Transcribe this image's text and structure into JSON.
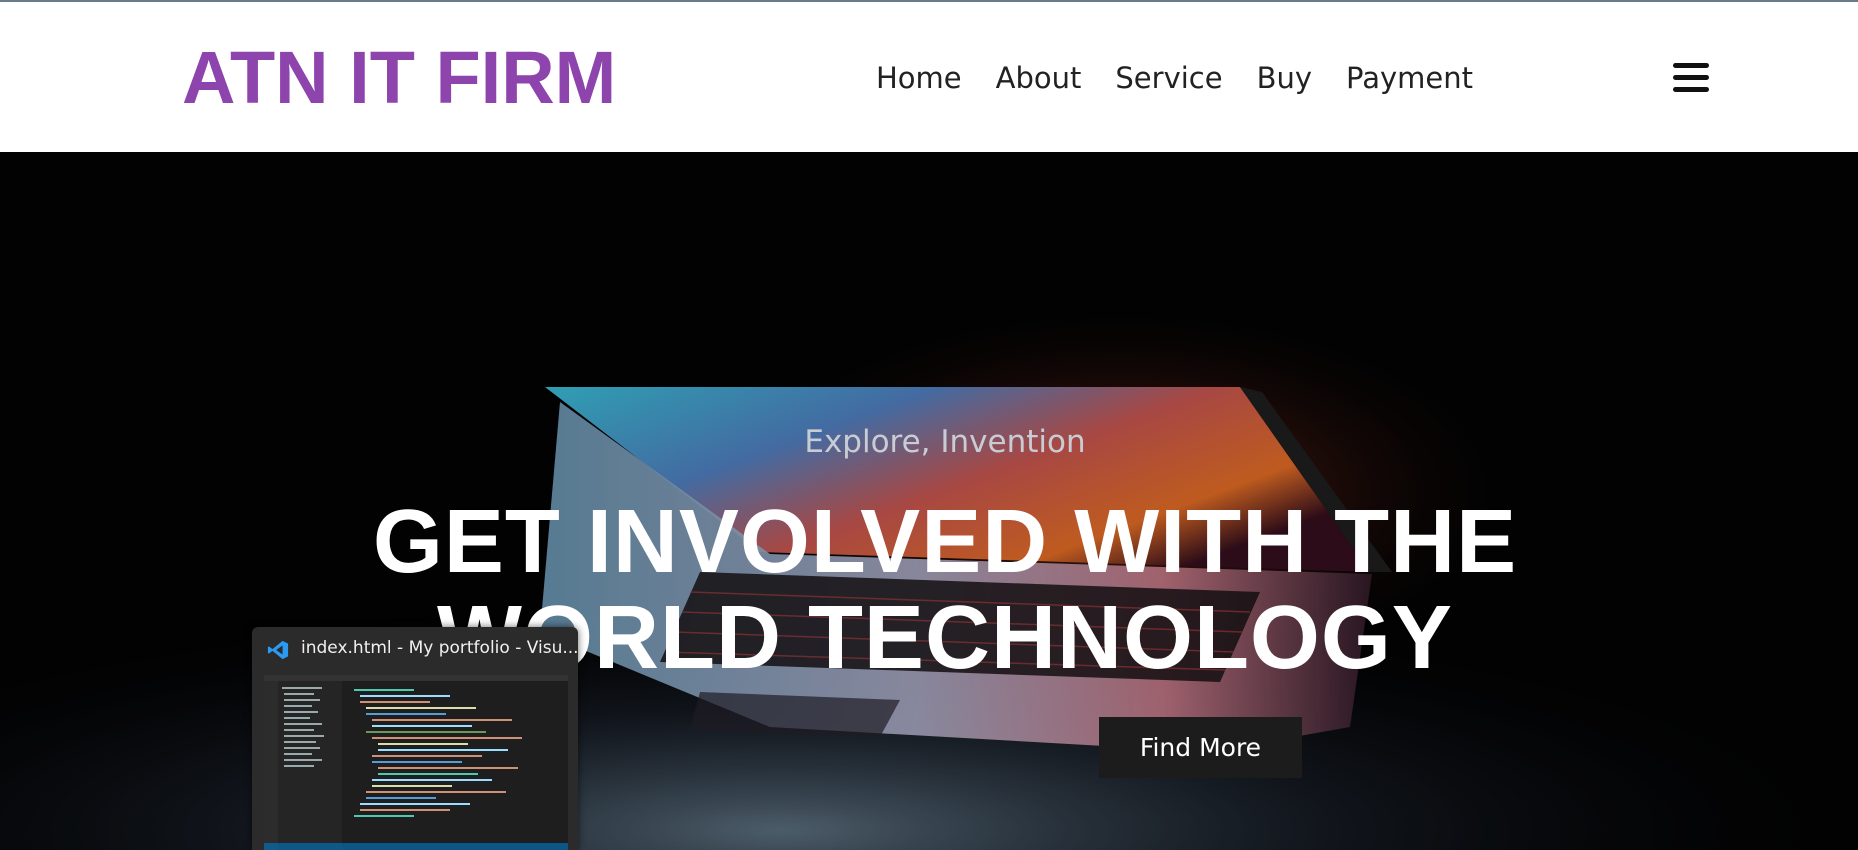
{
  "brand": {
    "logo_text": "ATN IT FIRM",
    "color": "#8e44ad"
  },
  "nav": {
    "items": [
      {
        "label": "Home"
      },
      {
        "label": "About"
      },
      {
        "label": "Service"
      },
      {
        "label": "Buy"
      },
      {
        "label": "Payment"
      }
    ],
    "menu_icon": "hamburger-menu-icon"
  },
  "hero": {
    "subtitle": "Explore, Invention",
    "title_line1": "GET INVOLVED WITH THE",
    "title_line2": "WORLD TECHNOLOGY",
    "button_label": "Find More",
    "background_image": "laptop-glowing-screen-in-dark"
  },
  "taskbar_preview": {
    "app_icon": "vscode-icon",
    "window_title": "index.html - My portfolio - Visu..."
  }
}
